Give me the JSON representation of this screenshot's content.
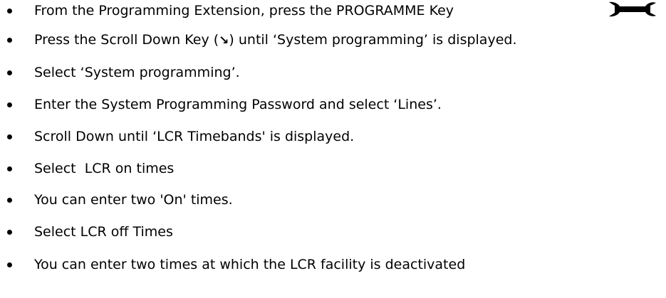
{
  "items": [
    {
      "text": "From the Programming Extension, press the PROGRAMME Key"
    },
    {
      "before": "Press the Scroll Down Key (",
      "arrow": "↘",
      "after": ") until ‘System programming’ is displayed."
    },
    {
      "text": "Select ‘System programming’."
    },
    {
      "text": "Enter the System Programming Password and select ‘Lines’."
    },
    {
      "text": "Scroll Down until ‘LCR Timebands' is displayed."
    },
    {
      "text": "Select  LCR on times"
    },
    {
      "text": "You can enter two 'On' times."
    },
    {
      "text": "Select LCR off Times"
    },
    {
      "text": "You can enter two times at which the LCR facility is deactivated"
    }
  ],
  "icons": {
    "programme_key": "wrench-icon"
  },
  "colors": {
    "text": "#000000",
    "background": "#ffffff"
  }
}
